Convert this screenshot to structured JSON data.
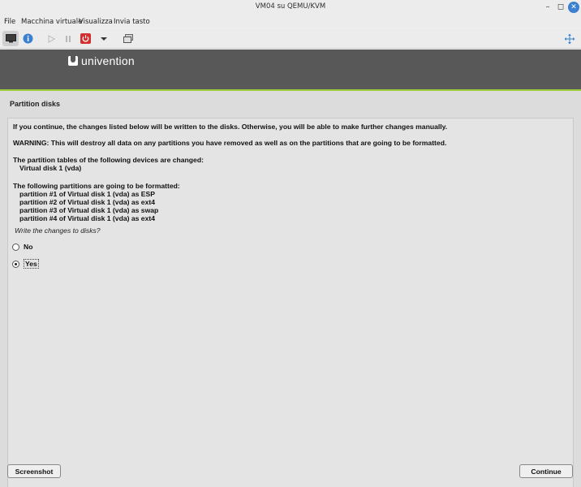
{
  "window": {
    "title": "VM04 su QEMU/KVM",
    "min_symbol": "–",
    "max_symbol": "◻",
    "close_symbol": "✕"
  },
  "menu": {
    "items": [
      "File",
      "Macchina virtuale",
      "Visualizza",
      "Invia tasto"
    ]
  },
  "toolbar": {
    "icons": [
      "console-icon",
      "info-icon",
      "play-icon",
      "pause-icon",
      "power-icon",
      "dropdown-arrow-icon",
      "snapshot-icon",
      "fullscreen-icon"
    ],
    "power_color": "#d32f2f",
    "info_color": "#3a7fd0"
  },
  "installer": {
    "brand": "univention",
    "banner_color": "#585858",
    "accent_color": "#9ccb3c",
    "section_title": "Partition disks",
    "line1": "If you continue, the changes listed below will be written to the disks. Otherwise, you will be able to make further changes manually.",
    "warning": "WARNING: This will destroy all data on any partitions you have removed as well as on the partitions that are going to be formatted.",
    "tables_heading": "The partition tables of the following devices are changed:",
    "tables_device": "Virtual disk 1 (vda)",
    "format_heading": "The following partitions are going to be formatted:",
    "partitions": [
      "partition #1 of Virtual disk 1 (vda) as ESP",
      "partition #2 of Virtual disk 1 (vda) as ext4",
      "partition #3 of Virtual disk 1 (vda) as swap",
      "partition #4 of Virtual disk 1 (vda) as ext4"
    ],
    "question": "Write the changes to disks?",
    "options": [
      {
        "label": "No",
        "selected": false
      },
      {
        "label": "Yes",
        "selected": true
      }
    ],
    "screenshot_button": "Screenshot",
    "continue_button": "Continue"
  }
}
